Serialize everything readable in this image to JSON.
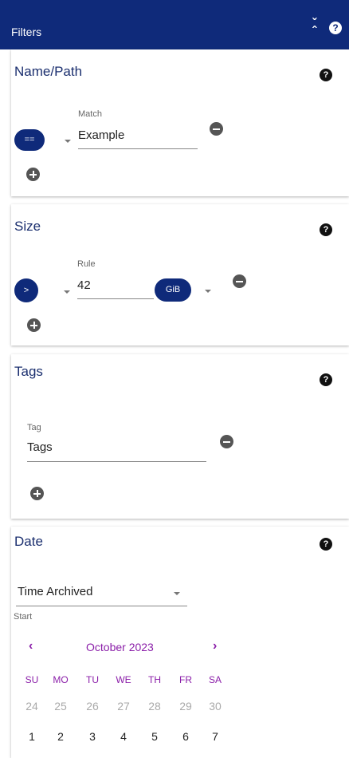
{
  "header": {
    "title": "Filters",
    "collapse_icon": "collapse-icon",
    "help_icon": "help-icon"
  },
  "sections": {
    "name_path": {
      "title": "Name/Path",
      "operator": "==",
      "field_label": "Match",
      "field_value": "Example"
    },
    "size": {
      "title": "Size",
      "operator": ">",
      "field_label": "Rule",
      "field_value": "42",
      "unit": "GiB"
    },
    "tags": {
      "title": "Tags",
      "field_label": "Tag",
      "field_value": "Tags"
    },
    "date": {
      "title": "Date",
      "date_type": "Time Archived",
      "start_label": "Start",
      "calendar": {
        "month_label": "October 2023",
        "prev": "‹",
        "next": "›",
        "weekdays": [
          "SU",
          "MO",
          "TU",
          "WE",
          "TH",
          "FR",
          "SA"
        ],
        "week1": [
          "24",
          "25",
          "26",
          "27",
          "28",
          "29",
          "30"
        ],
        "week2": [
          "1",
          "2",
          "3",
          "4",
          "5",
          "6",
          "7"
        ]
      }
    }
  },
  "help_symbol": "?",
  "colors": {
    "header_bg": "#0f2a7a",
    "accent_purple": "#8b1fa9",
    "title_blue": "#1a2e6e"
  }
}
